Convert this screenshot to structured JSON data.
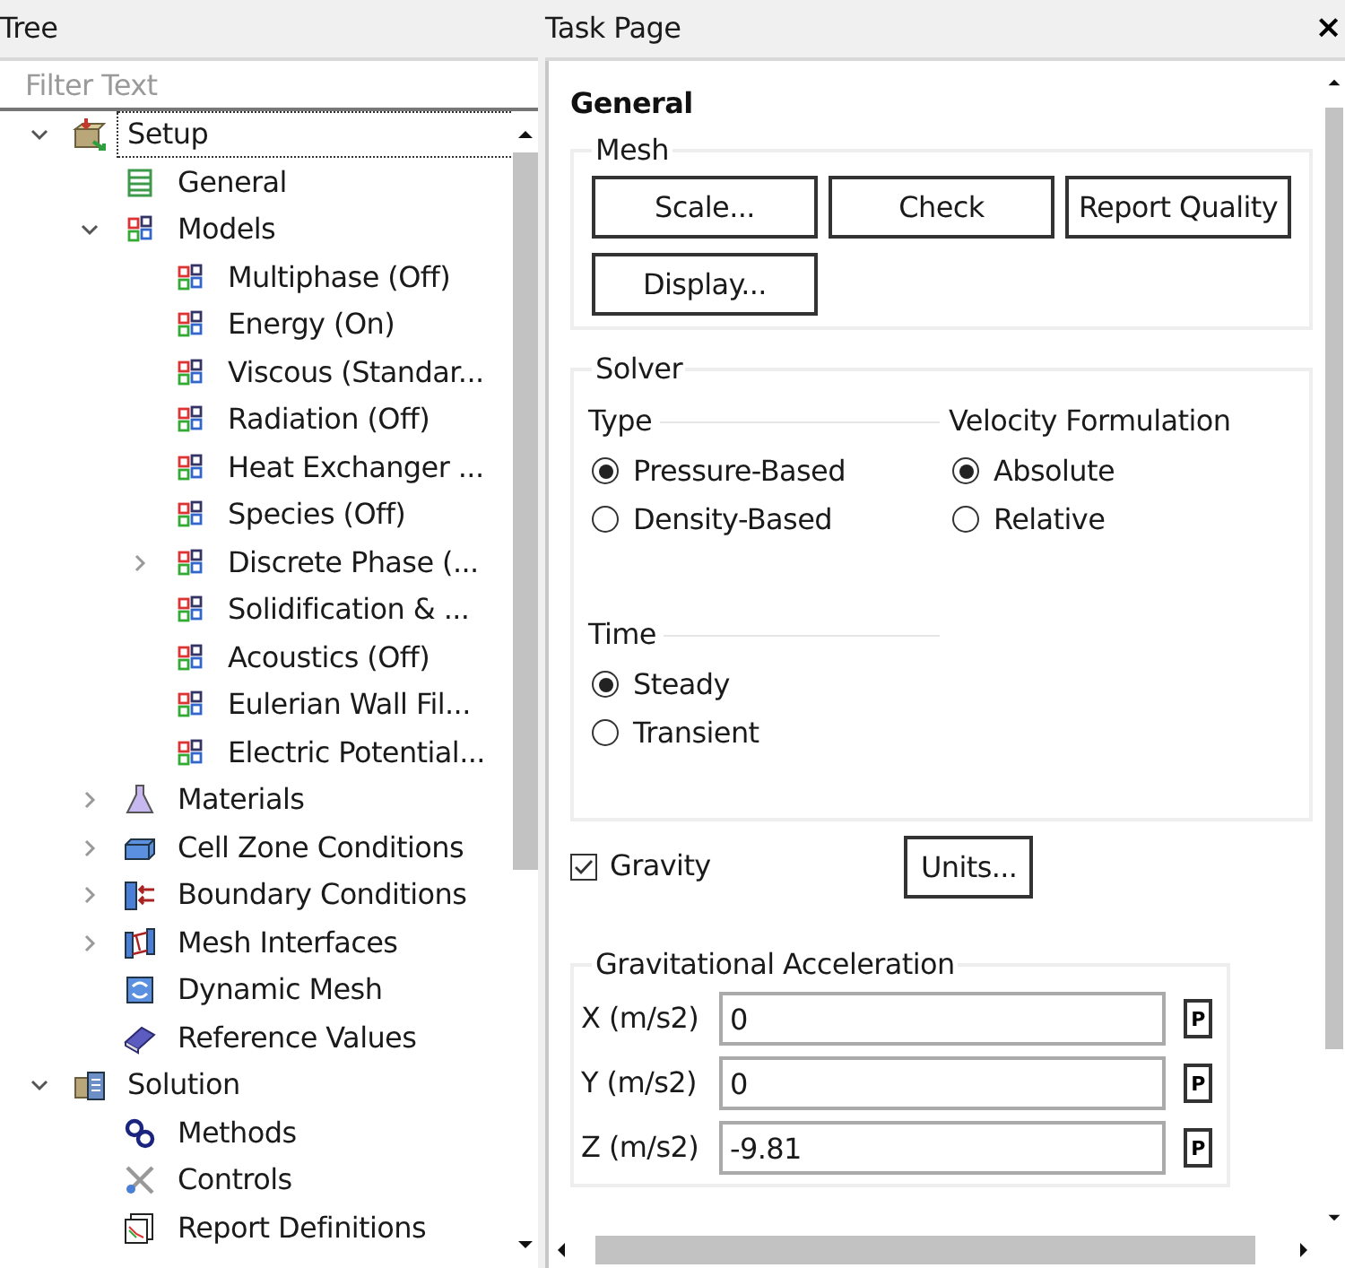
{
  "tree_panel": {
    "title": "Tree",
    "filter": {
      "placeholder": "Filter Text"
    },
    "nodes": [
      {
        "label": "Setup",
        "kind": "setup",
        "expanded": true,
        "selected": true,
        "children": [
          {
            "label": "General",
            "kind": "general",
            "selected": false
          },
          {
            "label": "Models",
            "kind": "model",
            "expanded": true,
            "selected": false,
            "children": [
              {
                "label": "Multiphase (Off)",
                "kind": "model",
                "selected": false
              },
              {
                "label": "Energy (On)",
                "kind": "model",
                "selected": false
              },
              {
                "label": "Viscous (Standar...",
                "kind": "model",
                "selected": false
              },
              {
                "label": "Radiation (Off)",
                "kind": "model",
                "selected": false
              },
              {
                "label": "Heat Exchanger ...",
                "kind": "model",
                "selected": false
              },
              {
                "label": "Species (Off)",
                "kind": "model",
                "selected": false
              },
              {
                "label": "Discrete Phase (...",
                "kind": "model",
                "expanded": false,
                "selected": false
              },
              {
                "label": "Solidification & ...",
                "kind": "model",
                "selected": false
              },
              {
                "label": "Acoustics (Off)",
                "kind": "model",
                "selected": false
              },
              {
                "label": "Eulerian Wall Fil...",
                "kind": "model",
                "selected": false
              },
              {
                "label": "Electric Potential...",
                "kind": "model",
                "selected": false
              }
            ]
          },
          {
            "label": "Materials",
            "kind": "materials",
            "expanded": false,
            "selected": false
          },
          {
            "label": "Cell Zone Conditions",
            "kind": "cell-zone",
            "expanded": false,
            "selected": false
          },
          {
            "label": "Boundary Conditions",
            "kind": "boundary",
            "expanded": false,
            "selected": false
          },
          {
            "label": "Mesh Interfaces",
            "kind": "interface",
            "expanded": false,
            "selected": false
          },
          {
            "label": "Dynamic Mesh",
            "kind": "dynamic-mesh",
            "selected": false
          },
          {
            "label": "Reference Values",
            "kind": "reference",
            "selected": false
          }
        ]
      },
      {
        "label": "Solution",
        "kind": "solution",
        "expanded": true,
        "selected": false,
        "children": [
          {
            "label": "Methods",
            "kind": "methods",
            "selected": false
          },
          {
            "label": "Controls",
            "kind": "controls",
            "selected": false
          },
          {
            "label": "Report Definitions",
            "kind": "report",
            "selected": false
          }
        ]
      }
    ]
  },
  "task_page": {
    "title": "Task Page",
    "close": "×",
    "heading": "General",
    "mesh": {
      "title": "Mesh",
      "buttons": [
        "Scale...",
        "Check",
        "Report Quality",
        "Display..."
      ]
    },
    "solver": {
      "title": "Solver",
      "type": {
        "title": "Type",
        "options": [
          {
            "label": "Pressure-Based",
            "selected": true
          },
          {
            "label": "Density-Based",
            "selected": false
          }
        ]
      },
      "velocity_formulation": {
        "title": "Velocity Formulation",
        "options": [
          {
            "label": "Absolute",
            "selected": true
          },
          {
            "label": "Relative",
            "selected": false
          }
        ]
      },
      "time": {
        "title": "Time",
        "options": [
          {
            "label": "Steady",
            "selected": true
          },
          {
            "label": "Transient",
            "selected": false
          }
        ]
      }
    },
    "gravity": {
      "label": "Gravity",
      "checked": true
    },
    "units_button": "Units...",
    "gravitational_acceleration": {
      "title": "Gravitational Acceleration",
      "fields": [
        {
          "label": "X (m/s2)",
          "value": "0",
          "parameter_button": "P"
        },
        {
          "label": "Y (m/s2)",
          "value": "0",
          "parameter_button": "P"
        },
        {
          "label": "Z (m/s2)",
          "value": "-9.81",
          "parameter_button": "P"
        }
      ]
    }
  }
}
